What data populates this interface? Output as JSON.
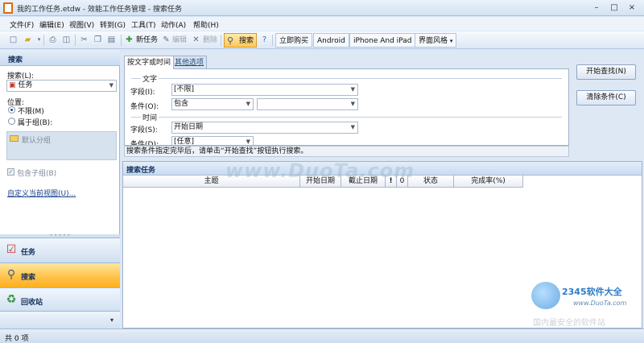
{
  "window": {
    "title": "我的工作任务.etdw - 效能工作任务管理 - 搜索任务",
    "controls": [
      "–",
      "□",
      "×"
    ]
  },
  "menu": [
    "文件(F)",
    "编辑(E)",
    "视图(V)",
    "转到(G)",
    "工具(T)",
    "动作(A)",
    "帮助(H)"
  ],
  "toolbar": {
    "new_task": "新任务",
    "edit": "编辑",
    "delete": "删除",
    "search": "搜索",
    "buy_now": "立即购买",
    "android": "Android",
    "iphone_ipad": "iPhone And iPad",
    "ui_style": "界面风格"
  },
  "left_panel": {
    "header": "搜索",
    "search_in_label": "搜索(L):",
    "search_in_value": "任务",
    "location_label": "位置:",
    "opt_no_group": "不限(M)",
    "opt_in_group": "属于组(B):",
    "default_group": "默认分组",
    "include_subgroups": "包含子组(B)",
    "customize_view": "自定义当前视图(U)...",
    "nav": {
      "tasks": "任务",
      "search": "搜索",
      "recycle": "回收站"
    }
  },
  "search_form": {
    "tabs": [
      "按文字或时间",
      "其他选项"
    ],
    "text_section": "文字",
    "field_label": "字段(I):",
    "field_value": "[不限]",
    "cond_label": "条件(O):",
    "cond_value": "包含",
    "cond_text": "",
    "time_section": "时间",
    "time_field_label": "字段(S):",
    "time_field_value": "开始日期",
    "time_cond_label": "条件(D):",
    "time_cond_value": "[任意]",
    "hint": "搜索条件指定完毕后，请单击“开始查找”按钮执行搜索。",
    "start_button": "开始查找(N)",
    "clear_button": "清除条件(C)"
  },
  "results": {
    "header": "搜索任务",
    "columns": [
      "主题",
      "开始日期",
      "截止日期",
      "!",
      "0",
      "状态",
      "完成率(%)"
    ]
  },
  "status": {
    "count": "共 0 项"
  },
  "watermarks": {
    "duota": "www.DuoTa.com",
    "brand": "2345软件大全",
    "url": "www.DuoTa.com",
    "cn": "国内最安全的软件站"
  }
}
